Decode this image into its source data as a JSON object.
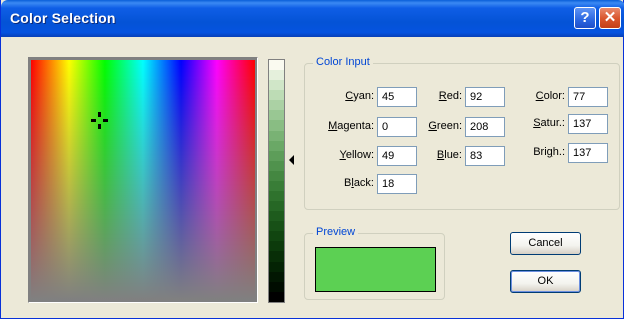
{
  "window": {
    "title": "Color Selection",
    "help_glyph": "?",
    "close_glyph": "✕"
  },
  "picker": {
    "marker": "crosshair-icon",
    "luminance_marker": "triangle-left-icon"
  },
  "color_input": {
    "group_label": "Color Input",
    "fields": {
      "cyan": {
        "label_u": "C",
        "label_rest": "yan:",
        "value": "45"
      },
      "magenta": {
        "label_u": "M",
        "label_rest": "agenta:",
        "value": "0"
      },
      "yellow": {
        "label_u": "Y",
        "label_rest": "ellow:",
        "value": "49"
      },
      "black": {
        "label_pre": "B",
        "label_u": "l",
        "label_rest": "ack:",
        "value": "18"
      },
      "red": {
        "label_u": "R",
        "label_rest": "ed:",
        "value": "92"
      },
      "green": {
        "label_u": "G",
        "label_rest": "reen:",
        "value": "208"
      },
      "blue": {
        "label_u": "B",
        "label_rest": "lue:",
        "value": "83"
      },
      "color": {
        "label_u": "C",
        "label_rest": "olor:",
        "value": "77"
      },
      "satur": {
        "label_u": "S",
        "label_rest": "atur.:",
        "value": "137"
      },
      "brigh": {
        "label_pre": "Bri",
        "label_u": "g",
        "label_rest": "h.:",
        "value": "137"
      }
    }
  },
  "preview": {
    "group_label": "Preview",
    "color": "#5cd053"
  },
  "buttons": {
    "cancel_label": "Cancel",
    "ok_label": "OK"
  }
}
